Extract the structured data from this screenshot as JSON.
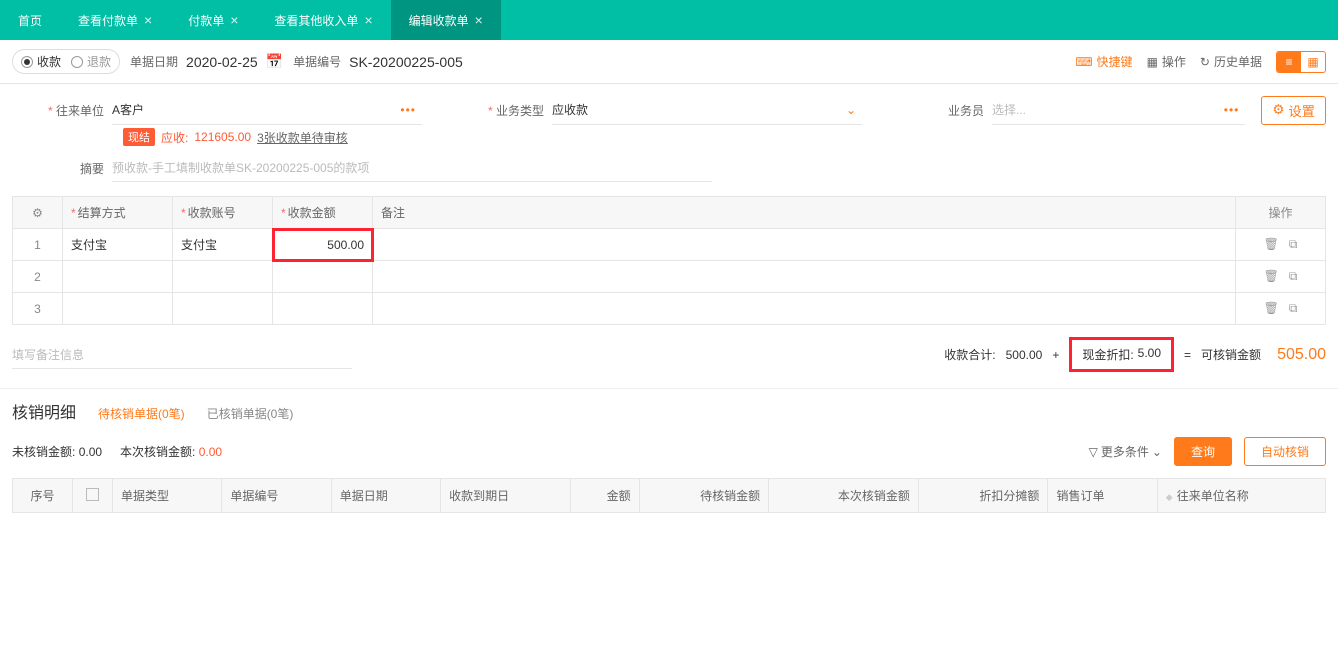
{
  "tabs": {
    "home": "首页",
    "view_pay": "查看付款单",
    "pay": "付款单",
    "view_other": "查看其他收入单",
    "edit_receipt": "编辑收款单"
  },
  "doc_type": {
    "receipt": "收款",
    "refund": "退款"
  },
  "doc_date": {
    "label": "单据日期",
    "value": "2020-02-25"
  },
  "doc_no": {
    "label": "单据编号",
    "value": "SK-20200225-005"
  },
  "toolbar": {
    "shortcut": "快捷键",
    "operate": "操作",
    "history": "历史单据"
  },
  "form": {
    "customer_label": "往来单位",
    "customer_value": "A客户",
    "biz_type_label": "业务类型",
    "biz_type_value": "应收款",
    "salesman_label": "业务员",
    "salesman_placeholder": "选择...",
    "settings": "设置",
    "badge": "现结",
    "receivable_label": "应收:",
    "receivable_value": "121605.00",
    "pending_audit": "3张收款单待审核",
    "summary_label": "摘要",
    "summary_placeholder": "预收款-手工填制收款单SK-20200225-005的款项"
  },
  "grid": {
    "headers": {
      "settle": "结算方式",
      "account": "收款账号",
      "amount": "收款金额",
      "remark": "备注",
      "op": "操作"
    },
    "rows": [
      {
        "no": "1",
        "settle": "支付宝",
        "account": "支付宝",
        "amount": "500.00"
      },
      {
        "no": "2"
      },
      {
        "no": "3"
      }
    ]
  },
  "totals": {
    "remark_placeholder": "填写备注信息",
    "sum_label": "收款合计:",
    "sum_value": "500.00",
    "plus": "+",
    "discount_label": "现金折扣:",
    "discount_value": "5.00",
    "eq": "=",
    "verifiable_label": "可核销金额",
    "verifiable_value": "505.00"
  },
  "detail": {
    "title": "核销明细",
    "tab_pending": "待核销单据(0笔)",
    "tab_done": "已核销单据(0笔)",
    "unverified_label": "未核销金额:",
    "unverified_value": "0.00",
    "this_label": "本次核销金额:",
    "this_value": "0.00",
    "filter": "更多条件",
    "query": "查询",
    "auto": "自动核销",
    "cols": {
      "seq": "序号",
      "type": "单据类型",
      "no": "单据编号",
      "date": "单据日期",
      "due": "收款到期日",
      "amount": "金额",
      "pending_amt": "待核销金额",
      "this_amt": "本次核销金额",
      "disc_share": "折扣分摊额",
      "order": "销售订单",
      "party": "往来单位名称"
    }
  }
}
